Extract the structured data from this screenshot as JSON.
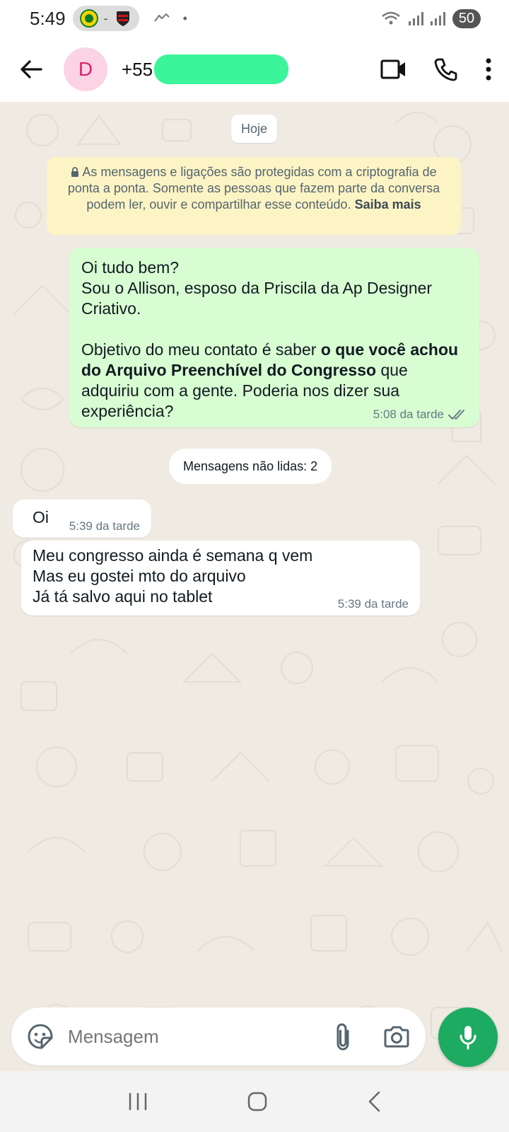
{
  "status_bar": {
    "time": "5:49",
    "dash": "-",
    "misc": "•",
    "battery": "50"
  },
  "header": {
    "avatar_initial": "D",
    "contact_number": "+55"
  },
  "chat": {
    "date_chip": "Hoje",
    "encryption_notice": {
      "text": "As mensagens e ligações são protegidas com a criptografia de ponta a ponta. Somente as pessoas que fazem parte da conversa podem ler, ouvir e compartilhar esse conteúdo.",
      "link": "Saiba mais"
    },
    "outgoing_message": {
      "line1": "Oi tudo bem?",
      "line2": "Sou o Allison, esposo da Priscila da Ap Designer Criativo.",
      "para2_start": "Objetivo do meu contato é saber ",
      "para2_bold": "o que você achou do Arquivo Preenchível do Congresso",
      "para2_end": " que adquiriu com a gente. Poderia nos dizer sua experiência?",
      "time": "5:08 da tarde"
    },
    "unread_chip": "Mensagens não lidas: 2",
    "incoming_messages": [
      {
        "text": "Oi",
        "time": "5:39 da tarde"
      },
      {
        "text": "Meu congresso ainda é semana q vem\nMas eu gostei mto do arquivo\nJá tá salvo aqui no tablet",
        "time": "5:39 da tarde"
      }
    ]
  },
  "composer": {
    "placeholder": "Mensagem"
  },
  "colors": {
    "outgoing_bubble": "#d9fdd3",
    "incoming_bubble": "#ffffff",
    "accent_green": "#1daa61",
    "notice_bg": "#fdf4c5"
  }
}
